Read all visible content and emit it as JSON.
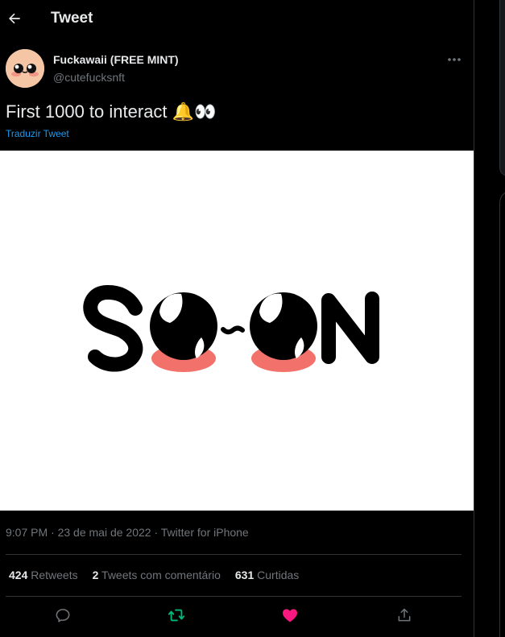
{
  "header": {
    "title": "Tweet",
    "back_icon": "arrow-left-icon"
  },
  "author": {
    "name": "Fuckawaii (FREE MINT)",
    "handle": "@cutefucksnft",
    "avatar_icon": "kawaii-face-avatar"
  },
  "tweet": {
    "text": "First 1000 to interact 🔔👀",
    "translate_label": "Traduzir Tweet",
    "media_alt": "SOON logo with kawaii eyes"
  },
  "meta": {
    "time": "9:07 PM",
    "separator1": " · ",
    "date": "23 de mai de 2022",
    "separator2": " · ",
    "source": "Twitter for iPhone"
  },
  "stats": {
    "retweets_count": "424",
    "retweets_label": " Retweets",
    "quotes_count": "2",
    "quotes_label": " Tweets com comentário",
    "likes_count": "631",
    "likes_label": " Curtidas"
  },
  "actions": {
    "reply_icon": "reply-icon",
    "retweet_icon": "retweet-icon",
    "like_icon": "heart-icon",
    "share_icon": "share-icon"
  },
  "colors": {
    "background": "#000000",
    "text": "#e7e9ea",
    "secondary": "#71767b",
    "link": "#1d9bf0",
    "retweet_active": "#00ba7c",
    "like_active": "#f91880",
    "divider": "#2f3336"
  }
}
